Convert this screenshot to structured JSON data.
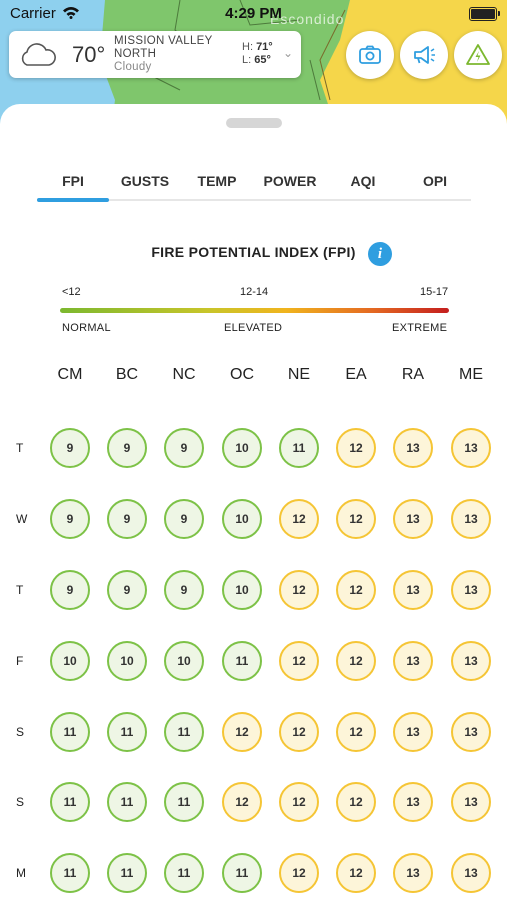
{
  "status_bar": {
    "carrier": "Carrier",
    "time": "4:29 PM"
  },
  "map": {
    "place_label": "Escondido"
  },
  "weather": {
    "temperature": "70°",
    "location_line1": "MISSION VALLEY",
    "location_line2": "NORTH",
    "condition": "Cloudy",
    "high_label": "H:",
    "high": "71°",
    "low_label": "L:",
    "low": "65°",
    "icon": "cloud-icon"
  },
  "actions": [
    {
      "name": "camera-button",
      "icon": "camera-icon"
    },
    {
      "name": "announcement-button",
      "icon": "megaphone-icon"
    },
    {
      "name": "alert-button",
      "icon": "power-warning-icon"
    }
  ],
  "tabs": [
    "FPI",
    "GUSTS",
    "TEMP",
    "POWER",
    "AQI",
    "OPI"
  ],
  "active_tab": "FPI",
  "fpi": {
    "title": "FIRE POTENTIAL INDEX (FPI)",
    "info_icon": "i",
    "scale": [
      "<12",
      "12-14",
      "15-17"
    ],
    "levels": [
      "NORMAL",
      "ELEVATED",
      "EXTREME"
    ]
  },
  "grid": {
    "columns": [
      "CM",
      "BC",
      "NC",
      "OC",
      "NE",
      "EA",
      "RA",
      "ME"
    ],
    "rows": [
      {
        "day": "T",
        "values": [
          "9",
          "9",
          "9",
          "10",
          "11",
          "12",
          "13",
          "13"
        ]
      },
      {
        "day": "W",
        "values": [
          "9",
          "9",
          "9",
          "10",
          "12",
          "12",
          "13",
          "13"
        ]
      },
      {
        "day": "T",
        "values": [
          "9",
          "9",
          "9",
          "10",
          "12",
          "12",
          "13",
          "13"
        ]
      },
      {
        "day": "F",
        "values": [
          "10",
          "10",
          "10",
          "11",
          "12",
          "12",
          "13",
          "13"
        ]
      },
      {
        "day": "S",
        "values": [
          "11",
          "11",
          "11",
          "12",
          "12",
          "12",
          "13",
          "13"
        ]
      },
      {
        "day": "S",
        "values": [
          "11",
          "11",
          "11",
          "12",
          "12",
          "12",
          "13",
          "13"
        ]
      },
      {
        "day": "M",
        "values": [
          "11",
          "11",
          "11",
          "11",
          "12",
          "12",
          "13",
          "13"
        ]
      }
    ]
  },
  "colors": {
    "accent": "#2f9ee0",
    "normal": "#7dc247",
    "elevated": "#f5c535",
    "map_green": "#7fc66c",
    "map_yellow": "#f5d64a",
    "water": "#8ed0ee"
  }
}
